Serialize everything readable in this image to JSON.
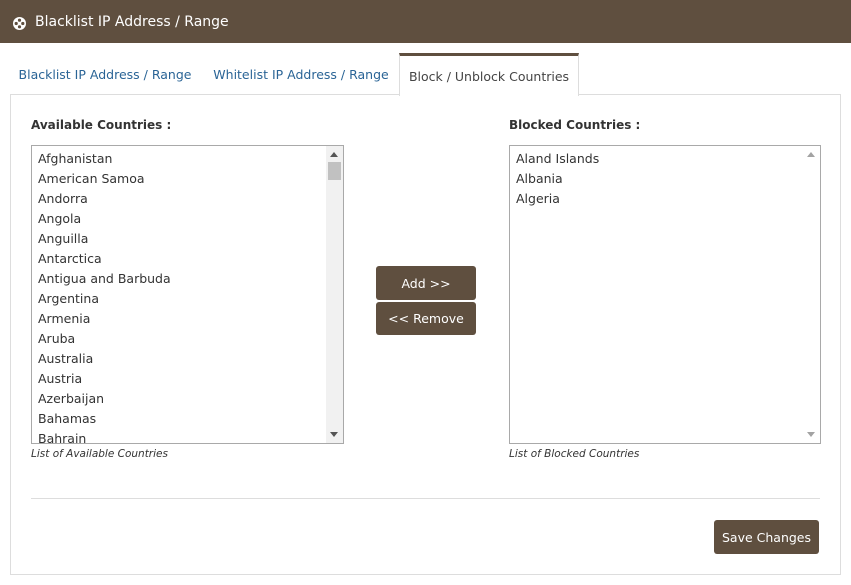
{
  "header": {
    "title": "Blacklist IP Address / Range"
  },
  "tabs": [
    {
      "label": "Blacklist IP Address / Range",
      "active": false
    },
    {
      "label": "Whitelist IP Address / Range",
      "active": false
    },
    {
      "label": "Block / Unblock Countries",
      "active": true
    }
  ],
  "available": {
    "label": "Available Countries :",
    "help": "List of Available Countries",
    "items": [
      "Afghanistan",
      "American Samoa",
      "Andorra",
      "Angola",
      "Anguilla",
      "Antarctica",
      "Antigua and Barbuda",
      "Argentina",
      "Armenia",
      "Aruba",
      "Australia",
      "Austria",
      "Azerbaijan",
      "Bahamas",
      "Bahrain"
    ]
  },
  "blocked": {
    "label": "Blocked Countries :",
    "help": "List of Blocked Countries",
    "items": [
      "Aland Islands",
      "Albania",
      "Algeria"
    ]
  },
  "buttons": {
    "add": "Add >>",
    "remove": "<< Remove",
    "save": "Save Changes"
  },
  "colors": {
    "brand": "#5f4f3f",
    "tab_link": "#2a6496"
  },
  "icons": {
    "header": "film-reel-icon"
  }
}
